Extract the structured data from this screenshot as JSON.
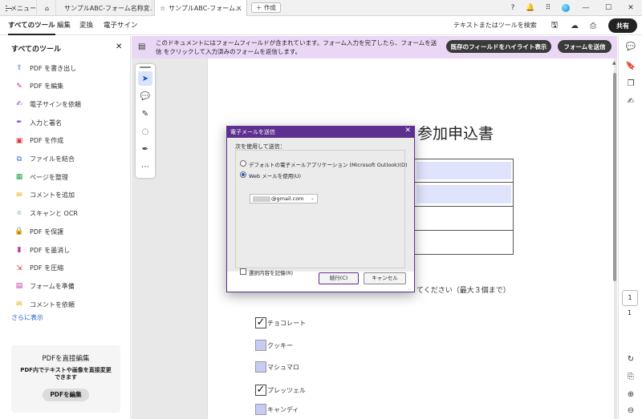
{
  "titlebar": {
    "menu_label": "メニュー",
    "tab1_label": "サンプルABC-フォーム名称変…",
    "tab2_label": "サンプルABC-フォーム…",
    "create_label": "＋ 作成"
  },
  "menubar": {
    "items": [
      "すべてのツール",
      "編集",
      "変換",
      "電子サイン"
    ],
    "search_label": "テキストまたはツールを検索",
    "share_label": "共有"
  },
  "left_panel": {
    "title": "すべてのツール",
    "tools": [
      {
        "label": "PDF を書き出し",
        "icon": "export-pdf-icon",
        "color": "#2a6fdb"
      },
      {
        "label": "PDF を編集",
        "icon": "edit-pdf-icon",
        "color": "#c2379b"
      },
      {
        "label": "電子サインを依頼",
        "icon": "request-esign-icon",
        "color": "#7b3fc4"
      },
      {
        "label": "入力と署名",
        "icon": "fill-sign-icon",
        "color": "#7b3fc4"
      },
      {
        "label": "PDF を作成",
        "icon": "create-pdf-icon",
        "color": "#d2343a"
      },
      {
        "label": "ファイルを結合",
        "icon": "combine-files-icon",
        "color": "#2a6fdb"
      },
      {
        "label": "ページを整理",
        "icon": "organize-pages-icon",
        "color": "#2aa84a"
      },
      {
        "label": "コメントを追加",
        "icon": "comment-icon",
        "color": "#e0a800"
      },
      {
        "label": "スキャンと OCR",
        "icon": "scan-ocr-icon",
        "color": "#2aa84a"
      },
      {
        "label": "PDF を保護",
        "icon": "protect-pdf-icon",
        "color": "#7b3fc4"
      },
      {
        "label": "PDF を墨消し",
        "icon": "redact-pdf-icon",
        "color": "#c2379b"
      },
      {
        "label": "PDF を圧縮",
        "icon": "compress-pdf-icon",
        "color": "#d2343a"
      },
      {
        "label": "フォームを準備",
        "icon": "prepare-form-icon",
        "color": "#c2379b"
      },
      {
        "label": "コメントを依頼",
        "icon": "request-comment-icon",
        "color": "#e0a800"
      }
    ],
    "more_label": "さらに表示",
    "edit_box": {
      "title": "PDFを直接編集",
      "desc": "PDF内でテキストや画像を直接変更できます",
      "button": "PDFを編集"
    }
  },
  "banner": {
    "text": "このドキュメントにはフォームフィールドが含まれています。フォーム入力を完了したら、フォームを送信 をクリックして入力済みのフォームを返信します。",
    "highlight_button": "既存のフィールドをハイライト表示",
    "submit_button": "フォームを送信"
  },
  "document": {
    "title": "参加申込書",
    "instruction": "てください（最大３個まで）",
    "checkboxes": [
      {
        "label": "チョコレート",
        "checked": true
      },
      {
        "label": "クッキー",
        "checked": false
      },
      {
        "label": "マシュマロ",
        "checked": false
      },
      {
        "label": "プレッツェル",
        "checked": true
      },
      {
        "label": "キャンディ",
        "checked": false
      }
    ]
  },
  "dialog": {
    "title": "電子メールを送信",
    "group_label": "次を使用して送信：",
    "option_default": "デフォルトの電子メールアプリケーション (Microsoft Outlook)(D)",
    "option_web": "Web メールを使用(U)",
    "email_suffix": "@gmail.com",
    "remember_label": "選択内容を記憶(R)",
    "continue_button": "続行(C)",
    "cancel_button": "キャンセル"
  },
  "page_nav": {
    "current": "1",
    "total": "1"
  },
  "colors": {
    "accent": "#5d2f8f",
    "banner": "#e9d7f5",
    "field": "#dfe3fb"
  }
}
